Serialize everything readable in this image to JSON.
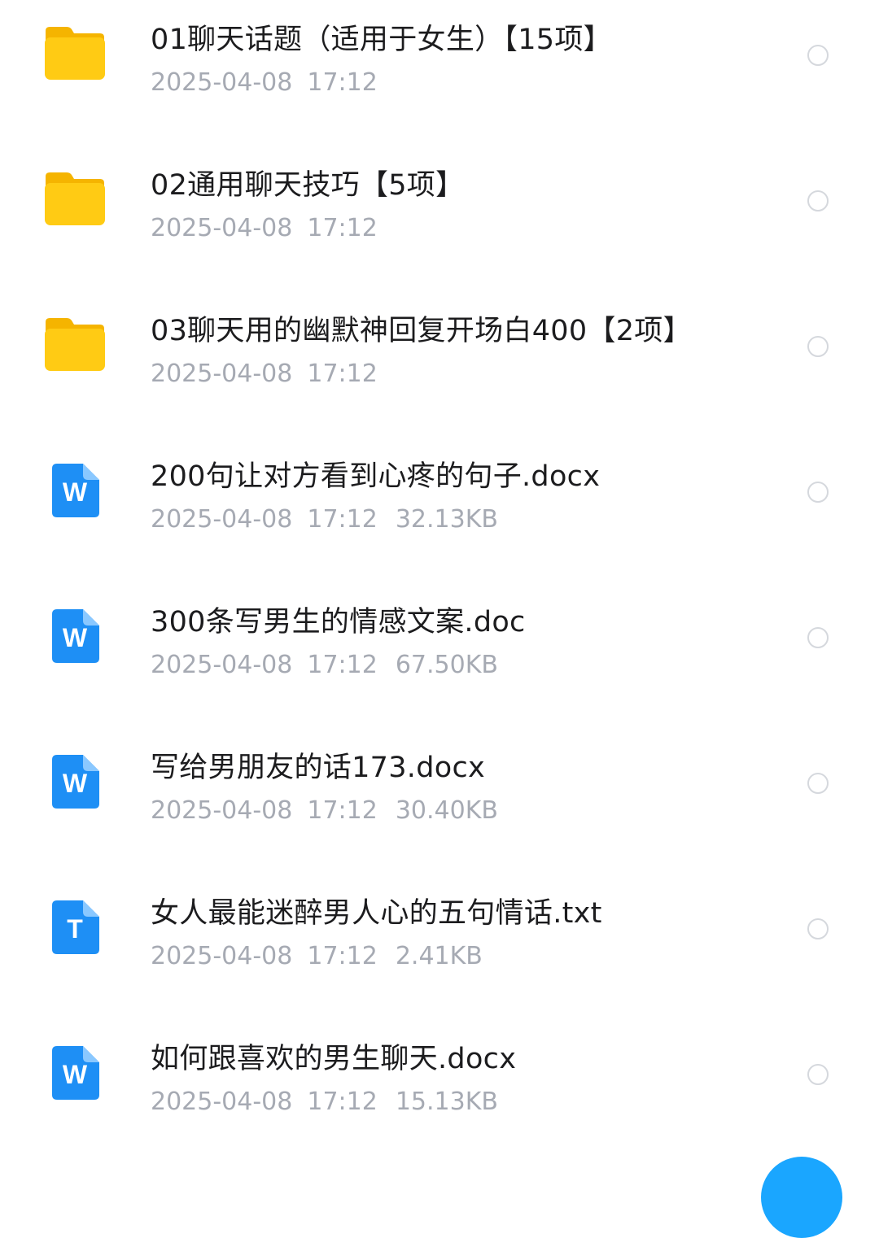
{
  "files": [
    {
      "type": "folder",
      "icon": "folder-icon",
      "name": "01聊天话题（适用于女生）【15项】",
      "date": "2025-04-08",
      "time": "17:12",
      "size": ""
    },
    {
      "type": "folder",
      "icon": "folder-icon",
      "name": "02通用聊天技巧【5项】",
      "date": "2025-04-08",
      "time": "17:12",
      "size": ""
    },
    {
      "type": "folder",
      "icon": "folder-icon",
      "name": "03聊天用的幽默神回复开场白400【2项】",
      "date": "2025-04-08",
      "time": "17:12",
      "size": ""
    },
    {
      "type": "word",
      "icon": "word-doc-icon",
      "name": "200句让对方看到心疼的句子.docx",
      "date": "2025-04-08",
      "time": "17:12",
      "size": "32.13KB"
    },
    {
      "type": "word",
      "icon": "word-doc-icon",
      "name": "300条写男生的情感文案.doc",
      "date": "2025-04-08",
      "time": "17:12",
      "size": "67.50KB"
    },
    {
      "type": "word",
      "icon": "word-doc-icon",
      "name": "写给男朋友的话173.docx",
      "date": "2025-04-08",
      "time": "17:12",
      "size": "30.40KB"
    },
    {
      "type": "text",
      "icon": "text-doc-icon",
      "name": "女人最能迷醉男人心的五句情话.txt",
      "date": "2025-04-08",
      "time": "17:12",
      "size": "2.41KB"
    },
    {
      "type": "word",
      "icon": "word-doc-icon",
      "name": "如何跟喜欢的男生聊天.docx",
      "date": "2025-04-08",
      "time": "17:12",
      "size": "15.13KB"
    }
  ],
  "icon_letters": {
    "word": "W",
    "text": "T"
  },
  "colors": {
    "folder": "#ffc400",
    "doc_blue": "#1e8ff5",
    "name_text": "#1c1c1e",
    "meta_text": "#a6aab3",
    "radio_border": "#d5d8dd",
    "fab": "#1aa6ff"
  }
}
